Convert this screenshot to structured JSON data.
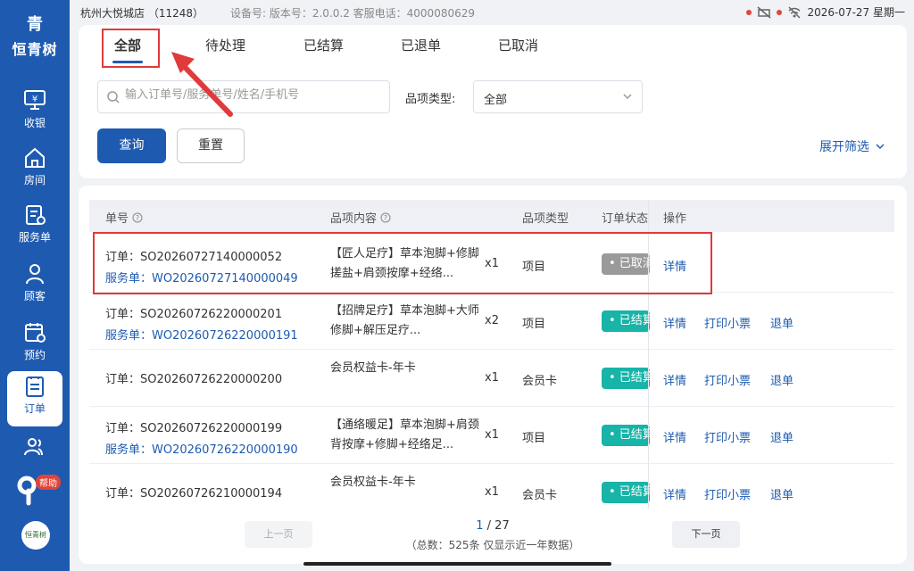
{
  "brand": {
    "name": "恒青树",
    "logo_char": "青"
  },
  "nav": [
    {
      "label": "收银",
      "icon": "cashier-icon"
    },
    {
      "label": "房间",
      "icon": "home-icon"
    },
    {
      "label": "服务单",
      "icon": "service-order-icon"
    },
    {
      "label": "顾客",
      "icon": "user-icon"
    },
    {
      "label": "预约",
      "icon": "calendar-icon"
    },
    {
      "label": "订单",
      "icon": "order-icon",
      "active": true
    },
    {
      "label": "",
      "icon": "users-icon"
    }
  ],
  "help": {
    "badge": "帮助"
  },
  "mini_logo": "恒青树",
  "statusbar": {
    "store": "杭州大悦城店  （11248）",
    "device": "设备号: 版本号：2.0.0.2  客服电话：4000080629",
    "datetime": "2026-07-27 星期一"
  },
  "tabs": [
    "全部",
    "待处理",
    "已结算",
    "已退单",
    "已取消"
  ],
  "search": {
    "placeholder": "输入订单号/服务单号/姓名/手机号"
  },
  "type_filter": {
    "label": "品项类型:",
    "value": "全部"
  },
  "buttons": {
    "query": "查询",
    "reset": "重置",
    "expand": "展开筛选"
  },
  "table": {
    "headers": [
      "单号",
      "品项内容",
      "品项类型",
      "订单状态",
      "操作"
    ],
    "rows": [
      {
        "order": "订单：SO20260727140000052",
        "service": "服务单：WO20260727140000049",
        "content": "【匠人足疗】草本泡脚+修脚搓盐+肩颈按摩+经络...",
        "qty": "x1",
        "type": "项目",
        "status": "• 已取消",
        "status_kind": "cancel",
        "ops": [
          "详情"
        ]
      },
      {
        "order": "订单：SO20260726220000201",
        "service": "服务单：WO20260726220000191",
        "content": "【招牌足疗】草本泡脚+大师修脚+解压足疗...",
        "qty": "x2",
        "type": "项目",
        "status": "• 已结算",
        "status_kind": "done",
        "ops": [
          "详情",
          "打印小票",
          "退单"
        ]
      },
      {
        "order": "订单：SO20260726220000200",
        "service": "",
        "content": "会员权益卡-年卡",
        "qty": "x1",
        "type": "会员卡",
        "status": "• 已结算",
        "status_kind": "done",
        "ops": [
          "详情",
          "打印小票",
          "退单"
        ]
      },
      {
        "order": "订单：SO20260726220000199",
        "service": "服务单：WO20260726220000190",
        "content": "【通络暖足】草本泡脚+肩颈背按摩+修脚+经络足...",
        "qty": "x1",
        "type": "项目",
        "status": "• 已结算",
        "status_kind": "done",
        "ops": [
          "详情",
          "打印小票",
          "退单"
        ]
      },
      {
        "order": "订单：SO20260726210000194",
        "service": "",
        "content": "会员权益卡-年卡",
        "qty": "x1",
        "type": "会员卡",
        "status": "• 已结算",
        "status_kind": "done",
        "ops": [
          "详情",
          "打印小票",
          "退单"
        ]
      }
    ]
  },
  "pager": {
    "prev": "上一页",
    "next": "下一页",
    "current": "1",
    "total_pages": "/ 27",
    "summary": "（总数：525条 仅显示近一年数据）"
  }
}
